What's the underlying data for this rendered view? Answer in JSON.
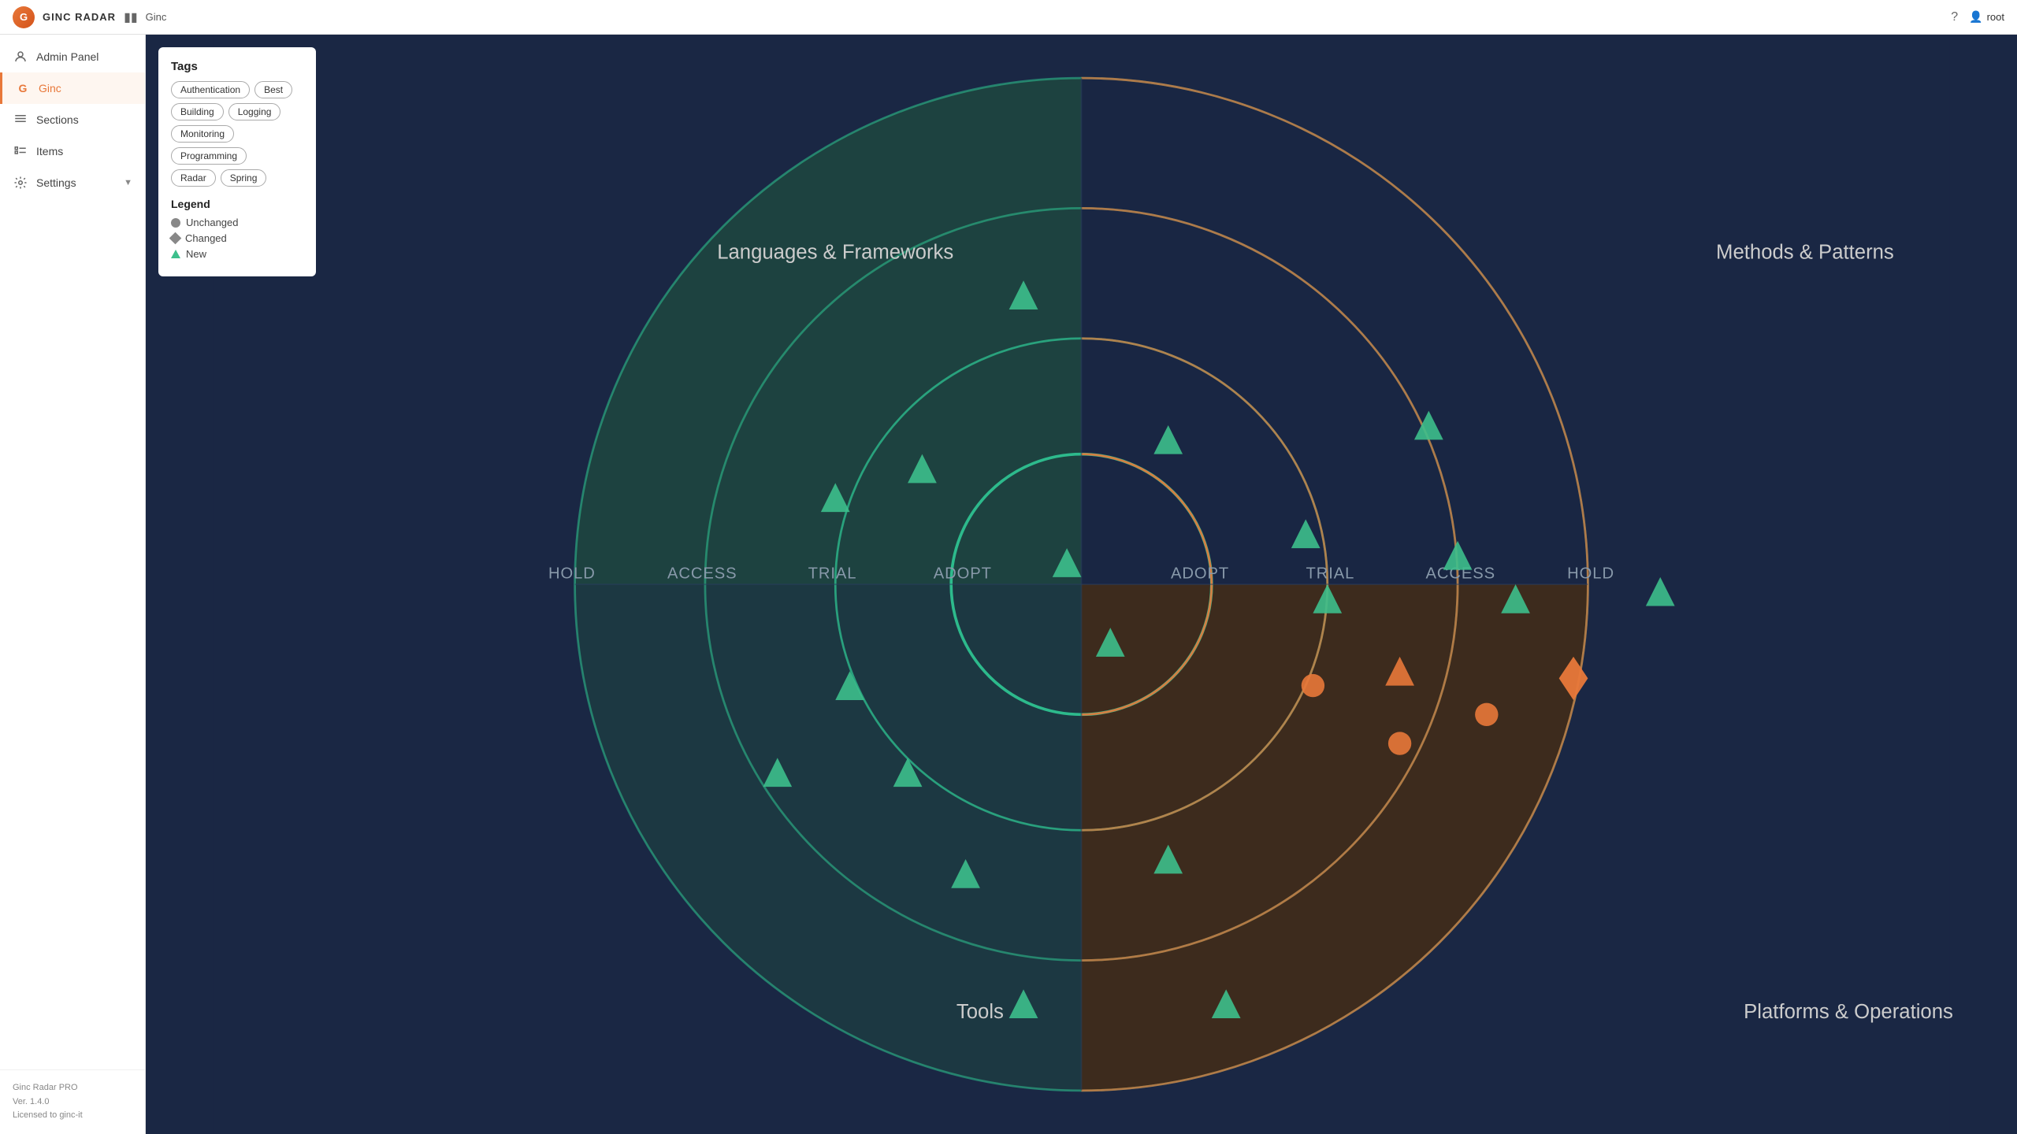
{
  "app": {
    "logo_text": "G",
    "title": "GINC RADAR",
    "breadcrumb": "Ginc"
  },
  "topbar": {
    "toggle_icon": "☰",
    "help_icon": "?",
    "user_label": "root",
    "user_icon": "👤"
  },
  "sidebar": {
    "items": [
      {
        "id": "admin-panel",
        "label": "Admin Panel",
        "icon": "⚙",
        "active": false
      },
      {
        "id": "ginc",
        "label": "Ginc",
        "icon": "G",
        "active": true
      },
      {
        "id": "sections",
        "label": "Sections",
        "icon": "≡",
        "active": false
      },
      {
        "id": "items",
        "label": "Items",
        "icon": "☰",
        "active": false
      },
      {
        "id": "settings",
        "label": "Settings",
        "icon": "⚙",
        "active": false,
        "has_sub": true
      }
    ],
    "footer": {
      "product": "Ginc Radar PRO",
      "version": "Ver. 1.4.0",
      "license": "Licensed to ginc-it"
    }
  },
  "tags": {
    "title": "Tags",
    "items": [
      "Authentication",
      "Best",
      "Building",
      "Logging",
      "Monitoring",
      "Programming",
      "Radar",
      "Spring"
    ]
  },
  "legend": {
    "title": "Legend",
    "items": [
      {
        "type": "circle",
        "label": "Unchanged"
      },
      {
        "type": "diamond",
        "label": "Changed"
      },
      {
        "type": "triangle",
        "label": "New"
      }
    ]
  },
  "radar": {
    "quadrant_labels": [
      "Languages & Frameworks",
      "Methods & Patterns",
      "Platforms & Operations",
      "Tools"
    ],
    "ring_labels": [
      "HOLD",
      "ACCESS",
      "TRIAL",
      "ADOPT",
      "ADOPT",
      "TRIAL",
      "ACCESS",
      "HOLD"
    ],
    "colors": {
      "teal_quadrant": "#1e4a4a",
      "orange_quadrant": "#3a2a1a",
      "ring_teal": "#2dba8c",
      "ring_orange": "#e8783a"
    }
  }
}
